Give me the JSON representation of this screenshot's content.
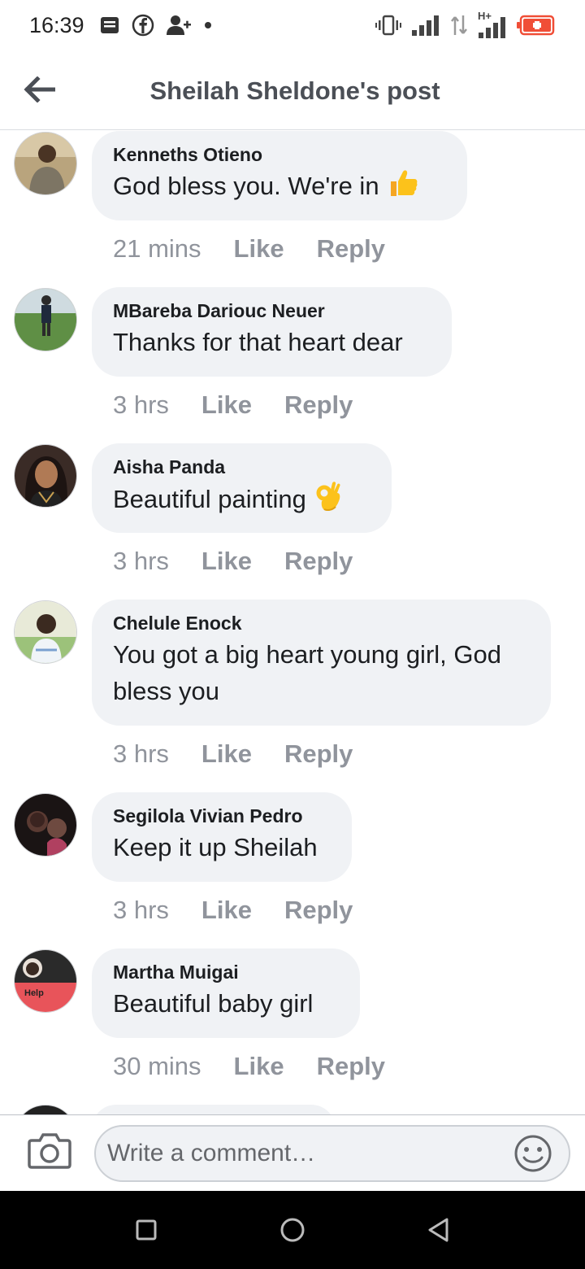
{
  "status_bar": {
    "time": "16:39",
    "left_icons": [
      "notes-icon",
      "facebook-icon",
      "add-person-icon",
      "dot-icon"
    ],
    "right_icons": [
      "vibrate-icon",
      "signal-icon",
      "data-arrows-icon",
      "hplus-signal-icon",
      "battery-icon"
    ],
    "network_label": "H+"
  },
  "header": {
    "title": "Sheilah Sheldone's post",
    "back_icon": "arrow-left-icon"
  },
  "comments": [
    {
      "author": "Kenneths Otieno",
      "text": "God bless you. We're in",
      "emoji": "thumbs-up-icon",
      "time": "21 mins",
      "like": "Like",
      "reply": "Reply"
    },
    {
      "author": "MBareba Dariouc Neuer",
      "text": "Thanks for that heart dear",
      "emoji": "",
      "time": "3 hrs",
      "like": "Like",
      "reply": "Reply"
    },
    {
      "author": "Aisha Panda",
      "text": "Beautiful painting",
      "emoji": "ok-hand-icon",
      "time": "3 hrs",
      "like": "Like",
      "reply": "Reply"
    },
    {
      "author": "Chelule Enock",
      "text": "You got a big heart young girl, God bless you",
      "emoji": "",
      "time": "3 hrs",
      "like": "Like",
      "reply": "Reply"
    },
    {
      "author": "Segilola Vivian Pedro",
      "text": "Keep it up Sheilah",
      "emoji": "",
      "time": "3 hrs",
      "like": "Like",
      "reply": "Reply"
    },
    {
      "author": "Martha Muigai",
      "text": "Beautiful baby girl",
      "emoji": "",
      "time": "30 mins",
      "like": "Like",
      "reply": "Reply"
    }
  ],
  "avatar_badge_text": "Help",
  "composer": {
    "placeholder": "Write a comment…",
    "camera_icon": "camera-icon",
    "emoji_icon": "smiley-icon"
  },
  "nav_bar": {
    "icons": [
      "recents-square-icon",
      "home-circle-icon",
      "back-triangle-icon"
    ]
  },
  "colors": {
    "bubble": "#f0f2f5",
    "meta_text": "#90949c",
    "title_text": "#4b4f56",
    "battery_red": "#f04e37"
  }
}
